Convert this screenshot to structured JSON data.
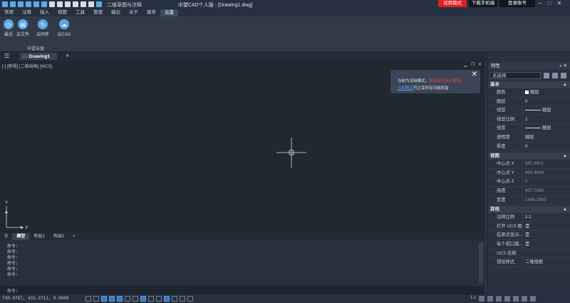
{
  "titlebar": {
    "workspace": "二维草图与注释",
    "title": "中望CAD个人版 - [Drawing1.dwg]",
    "trial_mode": "试用模式",
    "download_mobile": "下载手机端",
    "login": "登录账号",
    "minimize": "─",
    "maximize": "□",
    "close": "✕"
  },
  "menubar": {
    "items": [
      "常用",
      "注释",
      "插入",
      "视图",
      "工具",
      "管理",
      "输出",
      "关于",
      "服务",
      "云盘"
    ],
    "active": "云盘"
  },
  "ribbon": {
    "buttons": [
      {
        "label": "最近",
        "icon": "clock-icon"
      },
      {
        "label": "云文件",
        "icon": "cloud-file-icon"
      },
      {
        "label": "云同步",
        "icon": "cloud-sync-icon"
      },
      {
        "label": "云CAD",
        "icon": "cloud-cad-icon"
      }
    ],
    "group_label": "中望云盘"
  },
  "tabbar": {
    "doc_tab": "Drawing1",
    "add": "+"
  },
  "canvas": {
    "view_label": "[-] [俯视] [二维线框] [WCS]",
    "ucs_x": "X",
    "ucs_y": "Y"
  },
  "notification": {
    "line1_prefix": "当前为试用模式，",
    "line1_red": "购买后可永久使用。",
    "line2_link": "立即购买",
    "line2_suffix": "可立享所有功能权益",
    "close": "✕"
  },
  "layout_tabs": {
    "items": [
      "模型",
      "布局1",
      "布局2"
    ],
    "active": "模型",
    "add": "+"
  },
  "command": {
    "lines": [
      "命令:",
      "命令:",
      "命令:",
      "命令:",
      "命令:",
      "命令:"
    ],
    "prompt": "命令:"
  },
  "statusbar": {
    "coords": "730.9797, 433.3711, 0.0000",
    "annotation": "1:1"
  },
  "properties": {
    "title": "特性",
    "select": "无选择",
    "sections": [
      {
        "name": "基本",
        "rows": [
          {
            "k": "颜色",
            "v": "随层",
            "type": "swatch"
          },
          {
            "k": "图层",
            "v": "0"
          },
          {
            "k": "线型",
            "v": "随层",
            "type": "dash"
          },
          {
            "k": "线型比例",
            "v": "1"
          },
          {
            "k": "线宽",
            "v": "随层",
            "type": "dash"
          },
          {
            "k": "透明度",
            "v": "随层"
          },
          {
            "k": "厚度",
            "v": "0"
          }
        ]
      },
      {
        "name": "视图",
        "rows": [
          {
            "k": "中心点 X",
            "v": "555.8901",
            "dim": true
          },
          {
            "k": "中心点 Y",
            "v": "450.4994",
            "dim": true
          },
          {
            "k": "中心点 Z",
            "v": "0",
            "dim": true
          },
          {
            "k": "高度",
            "v": "607.7385",
            "dim": true
          },
          {
            "k": "宽度",
            "v": "1849.2965",
            "dim": true
          }
        ]
      },
      {
        "name": "其他",
        "rows": [
          {
            "k": "注释比例",
            "v": "1:1"
          },
          {
            "k": "打开 UCS 图...",
            "v": "是"
          },
          {
            "k": "在原点显示...",
            "v": "是"
          },
          {
            "k": "每个视口都...",
            "v": "是"
          },
          {
            "k": "UCS 名称",
            "v": ""
          },
          {
            "k": "视觉样式",
            "v": "二维线框"
          }
        ]
      }
    ]
  }
}
